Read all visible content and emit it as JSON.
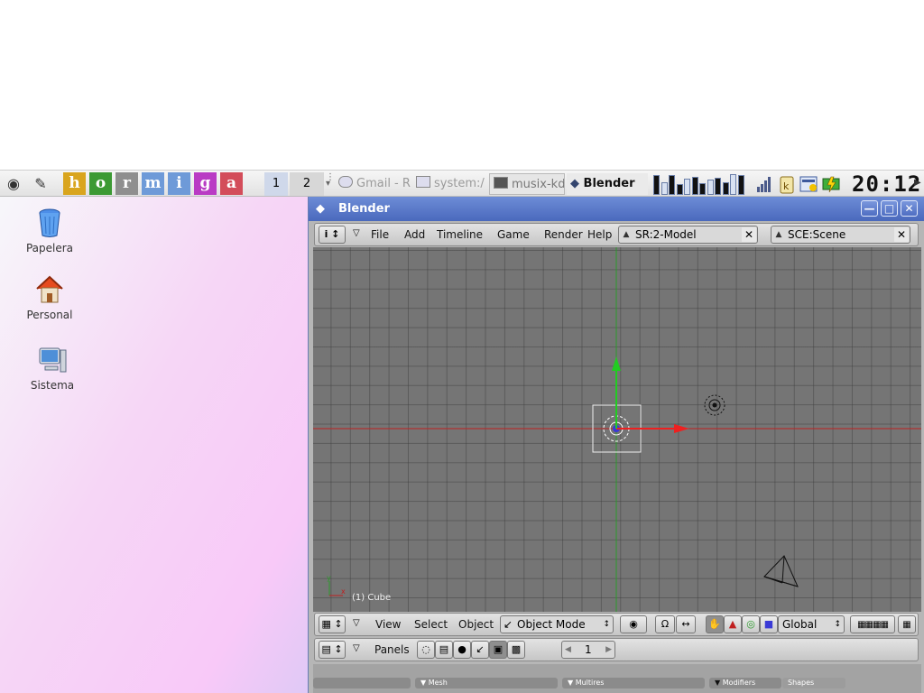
{
  "taskbar": {
    "logo_letters": [
      "h",
      "o",
      "r",
      "m",
      "i",
      "g",
      "a"
    ],
    "logo_colors": [
      "#d9a51e",
      "#3c9a34",
      "#8f8f8f",
      "#6e9ad8",
      "#6e9ad8",
      "#b93bc4",
      "#d34d5a"
    ],
    "pager": {
      "desk1": "1",
      "desk2": "2"
    },
    "tasks": [
      {
        "label": "Gmail - R"
      },
      {
        "label": "system:/"
      },
      {
        "label": "musix-kd"
      },
      {
        "label": "Blender"
      }
    ],
    "cpu_levels": [
      0.9,
      0.6,
      0.9,
      0.5,
      0.75,
      0.85,
      0.55,
      0.7,
      0.8,
      0.6,
      0.95,
      0.9
    ],
    "clock": "20:12"
  },
  "desktop": {
    "icons": [
      {
        "label": "Papelera",
        "icon": "trash-icon"
      },
      {
        "label": "Personal",
        "icon": "home-icon"
      },
      {
        "label": "Sistema",
        "icon": "computer-icon"
      }
    ]
  },
  "blender": {
    "title": "Blender",
    "top_menu": [
      "File",
      "Add",
      "Timeline",
      "Game",
      "Render",
      "Help"
    ],
    "screen_selector": "SR:2-Model",
    "scene_selector": "SCE:Scene",
    "viewport_label": "(1) Cube",
    "view_menu": [
      "View",
      "Select",
      "Object"
    ],
    "mode": "Object Mode",
    "orientation": "Global",
    "panels_label": "Panels",
    "frame": "1",
    "panel_tabs": [
      "Mesh",
      "Multires",
      "Modifiers",
      "Shapes"
    ]
  }
}
